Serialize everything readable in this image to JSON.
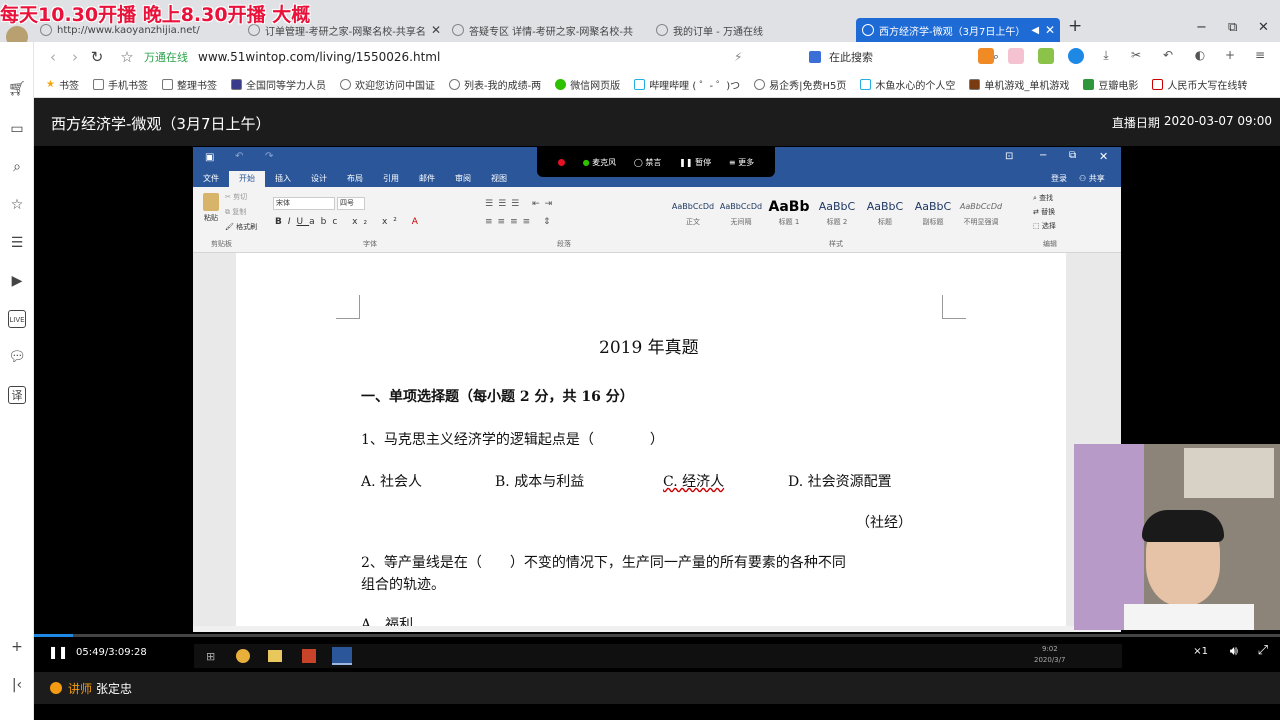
{
  "overlay_text": "每天10.30开播 晚上8.30开播 大概",
  "browser": {
    "tabs": [
      {
        "label": "http://www.kaoyanzhijia.net/",
        "active": false
      },
      {
        "label": "订单管理-考研之家-网聚名校-共享名",
        "active": false
      },
      {
        "label": "答疑专区 详情-考研之家-网聚名校-共",
        "active": false
      },
      {
        "label": "我的订单 - 万通在线",
        "active": false
      },
      {
        "label": "西方经济学-微观（3月7日上午）",
        "active": true
      }
    ],
    "new_tab": "+",
    "window_controls": [
      "−",
      "⧉",
      "✕"
    ],
    "address": {
      "brand": "万通在线",
      "url": "www.51wintop.com/living/1550026.html"
    },
    "search_placeholder": "在此搜索",
    "bookmarks": [
      "书签",
      "手机书签",
      "整理书签",
      "全国同等学力人员",
      "欢迎您访问中国证",
      "列表-我的成绩-两",
      "微信网页版",
      "哔哩哔哩 ( ゜- ゜)つ",
      "易企秀|免费H5页",
      "木鱼水心的个人空",
      "单机游戏_单机游戏",
      "豆瓣电影",
      "人民币大写在线转"
    ]
  },
  "player": {
    "course_title": "西方经济学-微观（3月7日上午）",
    "live_date_label": "直播日期",
    "live_date_value": "2020-03-07 09:00"
  },
  "word": {
    "tabs": [
      "文件",
      "开始",
      "插入",
      "设计",
      "布局",
      "引用",
      "邮件",
      "审阅",
      "视图"
    ],
    "active_tab": "开始",
    "user": {
      "login": "登录",
      "share": "共享"
    },
    "font_name": "宋体",
    "font_size": "四号",
    "groups": [
      "剪贴板",
      "字体",
      "段落",
      "样式",
      "编辑"
    ],
    "clipboard": {
      "paste": "粘贴",
      "cut": "剪切",
      "copy": "复制",
      "format_painter": "格式刷"
    },
    "styles": [
      {
        "preview": "AaBbCcDd",
        "label": "正文"
      },
      {
        "preview": "AaBbCcDd",
        "label": "无间隔"
      },
      {
        "preview": "AaBb",
        "label": "标题 1"
      },
      {
        "preview": "AaBbC",
        "label": "标题 2"
      },
      {
        "preview": "AaBbC",
        "label": "标题"
      },
      {
        "preview": "AaBbC",
        "label": "副标题"
      },
      {
        "preview": "AaBbCcDd",
        "label": "不明显强调"
      }
    ],
    "editing": {
      "find": "查找",
      "replace": "替换",
      "select": "选择"
    },
    "recorder": {
      "mic": "麦克风",
      "mute": "禁言",
      "pause": "暂停",
      "more": "更多"
    },
    "document": {
      "title": "2019 年真题",
      "section": "一、单项选择题（每小题 2 分，共 16 分）",
      "q1": "1、马克思主义经济学的逻辑起点是（　　　　）",
      "q1_options": [
        "A. 社会人",
        "B. 成本与利益",
        "C. 经济人",
        "D. 社会资源配置"
      ],
      "q1_source": "（社经）",
      "q2_line1": "2、等产量线是在（　　）不变的情况下，生产同一产量的所有要素的各种不同",
      "q2_line2": "组合的轨迹。",
      "q2_option_a": "A　福利"
    }
  },
  "controls": {
    "time": "05:49/3:09:28",
    "progress": 0.031,
    "speed": "×1",
    "taskbar_time": "9:02",
    "taskbar_date": "2020/3/7"
  },
  "footer": {
    "lecturer_label": "讲师",
    "lecturer_name": "张定忠"
  }
}
